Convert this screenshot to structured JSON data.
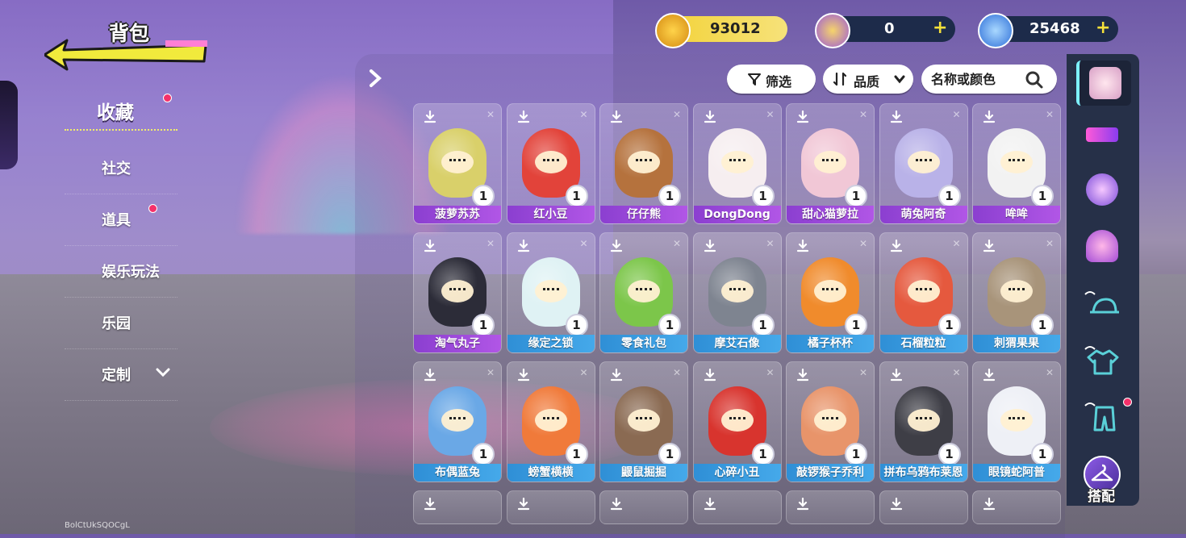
{
  "header": {
    "title": "背包"
  },
  "currencies": [
    {
      "name": "gold-coin",
      "value": "93012",
      "color": "#f6d63a",
      "has_plus": false
    },
    {
      "name": "star-coin",
      "value": "0",
      "color": "#c98bff",
      "has_plus": true
    },
    {
      "name": "diamond",
      "value": "25468",
      "color": "#4ba6ff",
      "has_plus": true
    }
  ],
  "left_menu": {
    "items": [
      {
        "label": "收藏",
        "active": true,
        "dot": true
      },
      {
        "label": "社交",
        "active": false,
        "dot": false
      },
      {
        "label": "道具",
        "active": false,
        "dot": true
      },
      {
        "label": "娱乐玩法",
        "active": false,
        "dot": false
      },
      {
        "label": "乐园",
        "active": false,
        "dot": false
      },
      {
        "label": "定制",
        "active": false,
        "dot": false,
        "expandable": true
      }
    ]
  },
  "toolbar": {
    "filter_label": "筛选",
    "sort_label": "品质",
    "search_placeholder": "名称或颜色"
  },
  "items": [
    {
      "name": "菠萝苏苏",
      "qty": "1",
      "rarity": "purple",
      "color": "#d9d06a"
    },
    {
      "name": "红小豆",
      "qty": "1",
      "rarity": "purple",
      "color": "#e2433a"
    },
    {
      "name": "仔仔熊",
      "qty": "1",
      "rarity": "purple",
      "color": "#b5723d"
    },
    {
      "name": "DongDong",
      "qty": "1",
      "rarity": "purple",
      "color": "#f6eef0"
    },
    {
      "name": "甜心猫萝拉",
      "qty": "1",
      "rarity": "purple",
      "color": "#f1c7d6"
    },
    {
      "name": "萌兔阿奇",
      "qty": "1",
      "rarity": "purple",
      "color": "#b9b2e8"
    },
    {
      "name": "哞哞",
      "qty": "1",
      "rarity": "purple",
      "color": "#f2f2f2"
    },
    {
      "name": "淘气丸子",
      "qty": "1",
      "rarity": "purple",
      "color": "#2c2c38"
    },
    {
      "name": "缘定之锁",
      "qty": "1",
      "rarity": "blue",
      "color": "#dff2f4"
    },
    {
      "name": "零食礼包",
      "qty": "1",
      "rarity": "blue",
      "color": "#7cc64a"
    },
    {
      "name": "摩艾石像",
      "qty": "1",
      "rarity": "blue",
      "color": "#7e8490"
    },
    {
      "name": "橘子杯杯",
      "qty": "1",
      "rarity": "blue",
      "color": "#f08b2c"
    },
    {
      "name": "石榴粒粒",
      "qty": "1",
      "rarity": "blue",
      "color": "#e5593e"
    },
    {
      "name": "刺猬果果",
      "qty": "1",
      "rarity": "blue",
      "color": "#a8947a"
    },
    {
      "name": "布偶蓝兔",
      "qty": "1",
      "rarity": "blue",
      "color": "#6aa8e6"
    },
    {
      "name": "螃蟹横横",
      "qty": "1",
      "rarity": "blue",
      "color": "#f07a3a"
    },
    {
      "name": "鼹鼠掘掘",
      "qty": "1",
      "rarity": "blue",
      "color": "#8a6a52"
    },
    {
      "name": "心碎小丑",
      "qty": "1",
      "rarity": "blue",
      "color": "#d8342e"
    },
    {
      "name": "敲锣猴子乔利",
      "qty": "1",
      "rarity": "blue",
      "color": "#e8946a"
    },
    {
      "name": "拼布乌鸦布莱恩",
      "qty": "1",
      "rarity": "blue",
      "color": "#3e3e46"
    },
    {
      "name": "眼镜蛇阿普",
      "qty": "1",
      "rarity": "blue",
      "color": "#eef0f6"
    }
  ],
  "rail": {
    "outfit_label": "搭配"
  },
  "watermark": "BolCtUkSQOCgL"
}
